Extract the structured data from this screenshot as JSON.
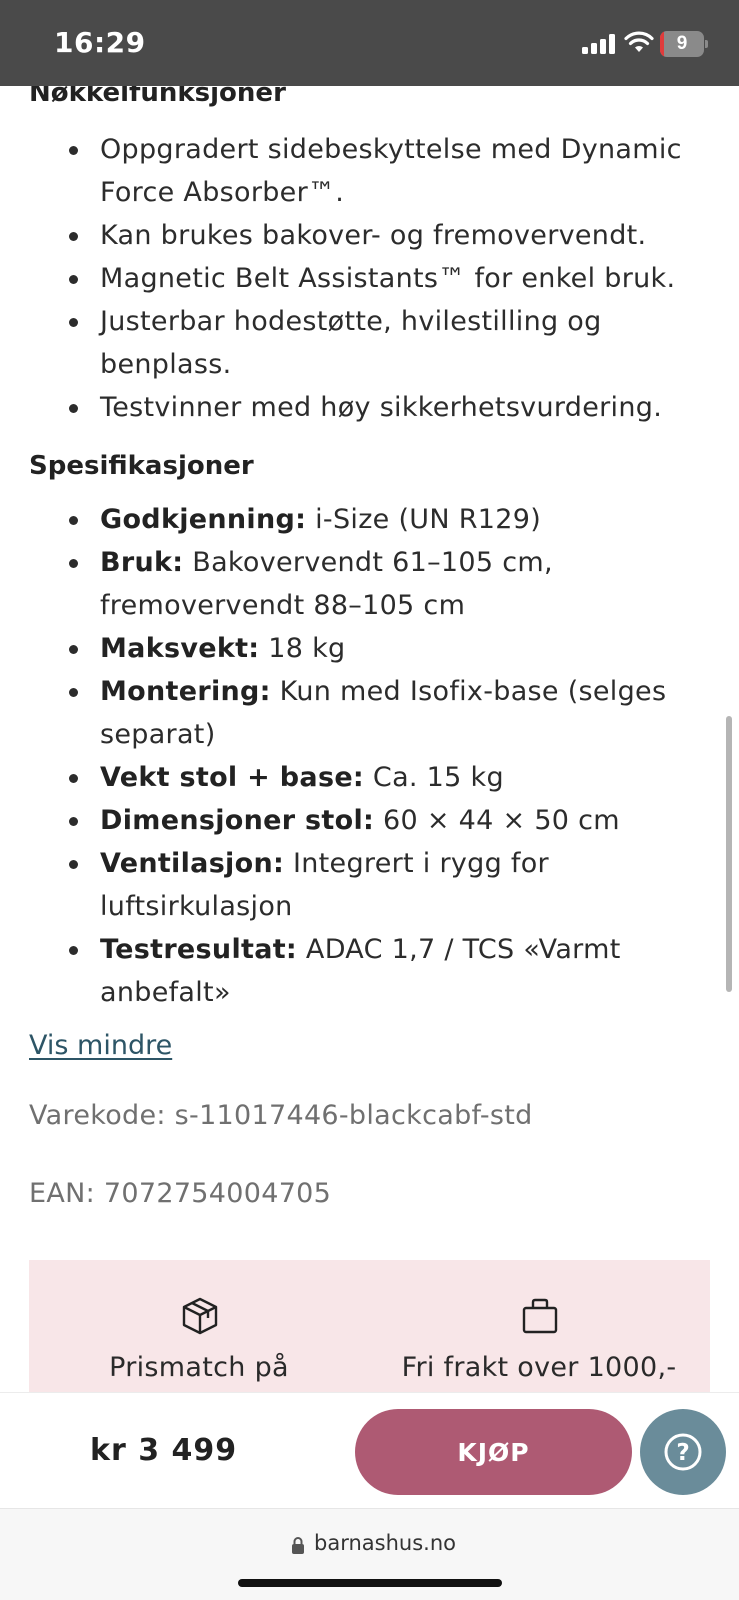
{
  "status_bar": {
    "time": "16:29",
    "battery_level": "9",
    "battery_fraction": 0.09
  },
  "product": {
    "features_heading": "Nøkkelfunksjoner",
    "features": [
      [
        "Oppgradert sidebeskyttelse med Dynamic",
        "Force Absorber™."
      ],
      [
        "Kan brukes bakover- og fremovervendt."
      ],
      [
        "Magnetic Belt Assistants™ for enkel bruk."
      ],
      [
        "Justerbar hodestøtte, hvilestilling og",
        "benplass."
      ],
      [
        "Testvinner med høy sikkerhetsvurdering."
      ]
    ],
    "specs_heading": "Spesifikasjoner",
    "specs": [
      {
        "label": "Godkjenning:",
        "value": [
          "i-Size (UN R129)"
        ]
      },
      {
        "label": "Bruk:",
        "value": [
          "Bakovervendt 61–105 cm,",
          "fremovervendt 88–105 cm"
        ]
      },
      {
        "label": "Maksvekt:",
        "value": [
          "18 kg"
        ]
      },
      {
        "label": "Montering:",
        "value": [
          "Kun med Isofix-base (selges",
          "separat)"
        ]
      },
      {
        "label": "Vekt stol + base:",
        "value": [
          "Ca. 15 kg"
        ]
      },
      {
        "label": "Dimensjoner stol:",
        "value": [
          "60 × 44 × 50 cm"
        ]
      },
      {
        "label": "Ventilasjon:",
        "value": [
          "Integrert i rygg for",
          "luftsirkulasjon"
        ]
      },
      {
        "label": "Testresultat:",
        "value": [
          "ADAC 1,7 / TCS «Varmt",
          "anbefalt»"
        ]
      }
    ],
    "show_less": "Vis mindre",
    "sku": "Varekode: s-11017446-blackcabf-std",
    "ean": "EAN: 7072754004705"
  },
  "usps": [
    {
      "icon": "package-icon",
      "text": "Prismatch på"
    },
    {
      "icon": "shopping-bag-icon",
      "text": "Fri frakt over 1000,-"
    }
  ],
  "buy_bar": {
    "price": "kr 3 499",
    "buy_label": "KJØP",
    "help_label": "?"
  },
  "browser": {
    "url": "barnashus.no"
  },
  "colors": {
    "buy_button": "#ae5a73",
    "help_button": "#6a8c9a",
    "usp_background": "#f8e6e8",
    "link": "#2d5566"
  }
}
